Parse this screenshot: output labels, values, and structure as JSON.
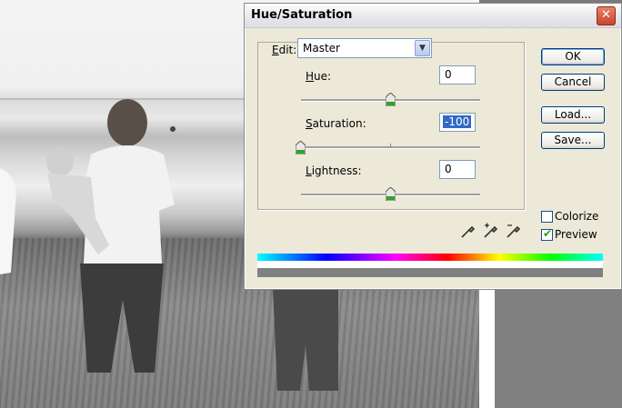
{
  "dialog": {
    "title": "Hue/Saturation",
    "edit_label": "Edit:",
    "edit_value": "Master",
    "hue": {
      "label": "Hue:",
      "value": "0",
      "slider": 0
    },
    "saturation": {
      "label": "Saturation:",
      "value": "-100",
      "slider": -100
    },
    "lightness": {
      "label": "Lightness:",
      "value": "0",
      "slider": 0
    },
    "buttons": {
      "ok": "OK",
      "cancel": "Cancel",
      "load": "Load...",
      "save": "Save..."
    },
    "colorize": {
      "label": "Colorize",
      "checked": false
    },
    "preview": {
      "label": "Preview",
      "checked": true
    },
    "icons": [
      "eyedropper-icon",
      "eyedropper-plus-icon",
      "eyedropper-minus-icon"
    ]
  },
  "colors": {
    "title_bar": "#e9e9ec",
    "close_button": "#c8452c",
    "dialog_bg": "#ece9d8",
    "canvas_bg": "#808080"
  }
}
